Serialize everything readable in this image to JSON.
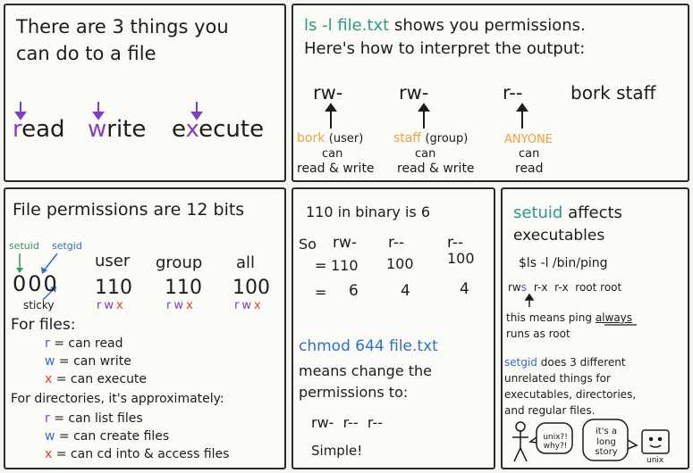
{
  "panel1": {
    "title_line1": "There are 3 things you",
    "title_line2": "can do to a file",
    "read_first": "r",
    "read_rest": "ead",
    "write_first": "w",
    "write_rest": "rite",
    "exec_prefix": "e",
    "exec_x": "x",
    "exec_rest": "ecute"
  },
  "panel2": {
    "line1_cmd": "ls -l file.txt",
    "line1_rest": "shows you permissions.",
    "line2": "Here's how to interpret the output:",
    "perm_user": "rw-",
    "perm_group": "rw-",
    "perm_other": "r--",
    "owner": "bork staff",
    "user_name": "bork",
    "user_tag": "(user)",
    "group_name": "staff",
    "group_tag": "(group)",
    "other_name": "ANYONE",
    "can": "can",
    "read_write": "read & write",
    "read_only": "read"
  },
  "panel3": {
    "title": "File permissions are 12 bits",
    "setuid": "setuid",
    "setgid": "setgid",
    "sticky": "sticky",
    "special_bits": "000",
    "user_label": "user",
    "group_label": "group",
    "all_label": "all",
    "user_bits": "110",
    "group_bits": "110",
    "all_bits": "100",
    "rwx_r": "r",
    "rwx_w": "w",
    "rwx_x": "x",
    "for_files": "For files:",
    "files": [
      {
        "letter": "r",
        "text": "= can read"
      },
      {
        "letter": "w",
        "text": "= can write"
      },
      {
        "letter": "x",
        "text": "= can execute"
      }
    ],
    "for_dirs": "For directories, it's approximately:",
    "dirs": [
      {
        "letter": "r",
        "text": "= can list files"
      },
      {
        "letter": "w",
        "text": "= can create files"
      },
      {
        "letter": "x",
        "text": "= can cd into & access files"
      }
    ]
  },
  "panel4": {
    "binary_line": "110 in binary is 6",
    "so": "So",
    "p1": "rw-",
    "p2": "r--",
    "p3": "r--",
    "eq": "=",
    "b1": "110",
    "b2": "100",
    "b3": "100",
    "d1": "6",
    "d2": "4",
    "d3": "4",
    "chmod": "chmod 644 file.txt",
    "means1": "means change the",
    "means2": "permissions to:",
    "result": "rw-  r--  r--",
    "simple": "Simple!"
  },
  "panel5": {
    "setuid_word": "setuid",
    "affects": "affects",
    "executables": "executables",
    "cmd": "$ls -l /bin/ping",
    "rws_rw": "rw",
    "rws_s": "s",
    "rest_perms": "r-x  r-x  root root",
    "note1_a": "this means ping",
    "note1_always": "always",
    "note2": "runs as root",
    "setgid_word": "setgid",
    "setgid_rest": "does 3 different",
    "line2": "unrelated things for",
    "line3": "executables, directories,",
    "line4": "and regular files.",
    "bubble1": "unix?! why?!",
    "bubble2": "it's a long story",
    "unix_label": "unix"
  }
}
